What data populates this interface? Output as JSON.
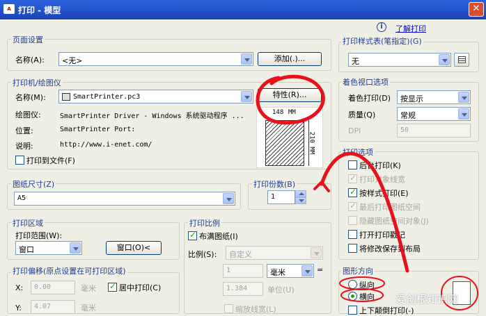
{
  "window": {
    "title": "打印 - 模型",
    "app_icon": "A",
    "close": "✕"
  },
  "help": {
    "icon": "i",
    "link": "了解打印"
  },
  "page_setup": {
    "group": "页面设置",
    "name_label": "名称(A):",
    "name_value": "<无>",
    "add_button": "添加(.)..."
  },
  "printer": {
    "group": "打印机/绘图仪",
    "name_label": "名称(M):",
    "name_value": "SmartPrinter.pc3",
    "properties_button": "特性(R)...",
    "plotter_label": "绘图仪:",
    "plotter_value": "SmartPrinter Driver - Windows 系统驱动程序 ...",
    "location_label": "位置:",
    "location_value": "SmartPrinter Port:",
    "description_label": "说明:",
    "description_value": "http://www.i-enet.com/",
    "print_to_file": "打印到文件(F)",
    "preview_width": "148",
    "preview_width_unit": "MM",
    "preview_height": "210 MM"
  },
  "paper_size": {
    "group": "图纸尺寸(Z)",
    "value": "A5"
  },
  "copies": {
    "group": "打印份数(B)",
    "value": "1"
  },
  "plot_area": {
    "group": "打印区域",
    "range_label": "打印范围(W):",
    "range_value": "窗口",
    "window_button": "窗口(O)<"
  },
  "plot_offset": {
    "group": "打印偏移(原点设置在可打印区域)",
    "x_label": "X:",
    "x_value": "0.00",
    "x_unit": "毫米",
    "center_plot": "居中打印(C)",
    "y_label": "Y:",
    "y_value": "4.07",
    "y_unit": "毫米"
  },
  "plot_scale": {
    "group": "打印比例",
    "fit_paper": "布满图纸(I)",
    "scale_label": "比例(S):",
    "scale_value": "自定义",
    "value1": "1",
    "unit_value": "毫米",
    "equals": "=",
    "value2": "1.384",
    "unit_label": "单位(U)",
    "scale_lineweights": "缩放线宽(L)"
  },
  "style_table": {
    "group": "打印样式表(笔指定)(G)",
    "value": "无"
  },
  "shaded_viewport": {
    "group": "着色视口选项",
    "shade_label": "着色打印(D)",
    "shade_value": "按显示",
    "quality_label": "质量(Q)",
    "quality_value": "常规",
    "dpi_label": "DPI",
    "dpi_value": "50"
  },
  "plot_options": {
    "group": "打印选项",
    "items": [
      {
        "label": "后台打印(K)",
        "checked": false,
        "enabled": true
      },
      {
        "label": "打印对象线宽",
        "checked": true,
        "enabled": false
      },
      {
        "label": "按样式打印(E)",
        "checked": true,
        "enabled": true
      },
      {
        "label": "最后打印图纸空间",
        "checked": true,
        "enabled": false
      },
      {
        "label": "隐藏图纸空间对象(J)",
        "checked": false,
        "enabled": false
      },
      {
        "label": "打开打印戳记",
        "checked": false,
        "enabled": true
      },
      {
        "label": "将修改保存到布局",
        "checked": false,
        "enabled": true
      }
    ]
  },
  "orientation": {
    "group": "图形方向",
    "portrait": "纵向",
    "landscape": "横向",
    "upside_down": "上下颠倒打印(-)"
  },
  "watermark": "爱创根知识网",
  "colors": {
    "titlebar": "#2154d0",
    "annotation_red": "#e8101a",
    "group_label": "#1f3b8c"
  }
}
